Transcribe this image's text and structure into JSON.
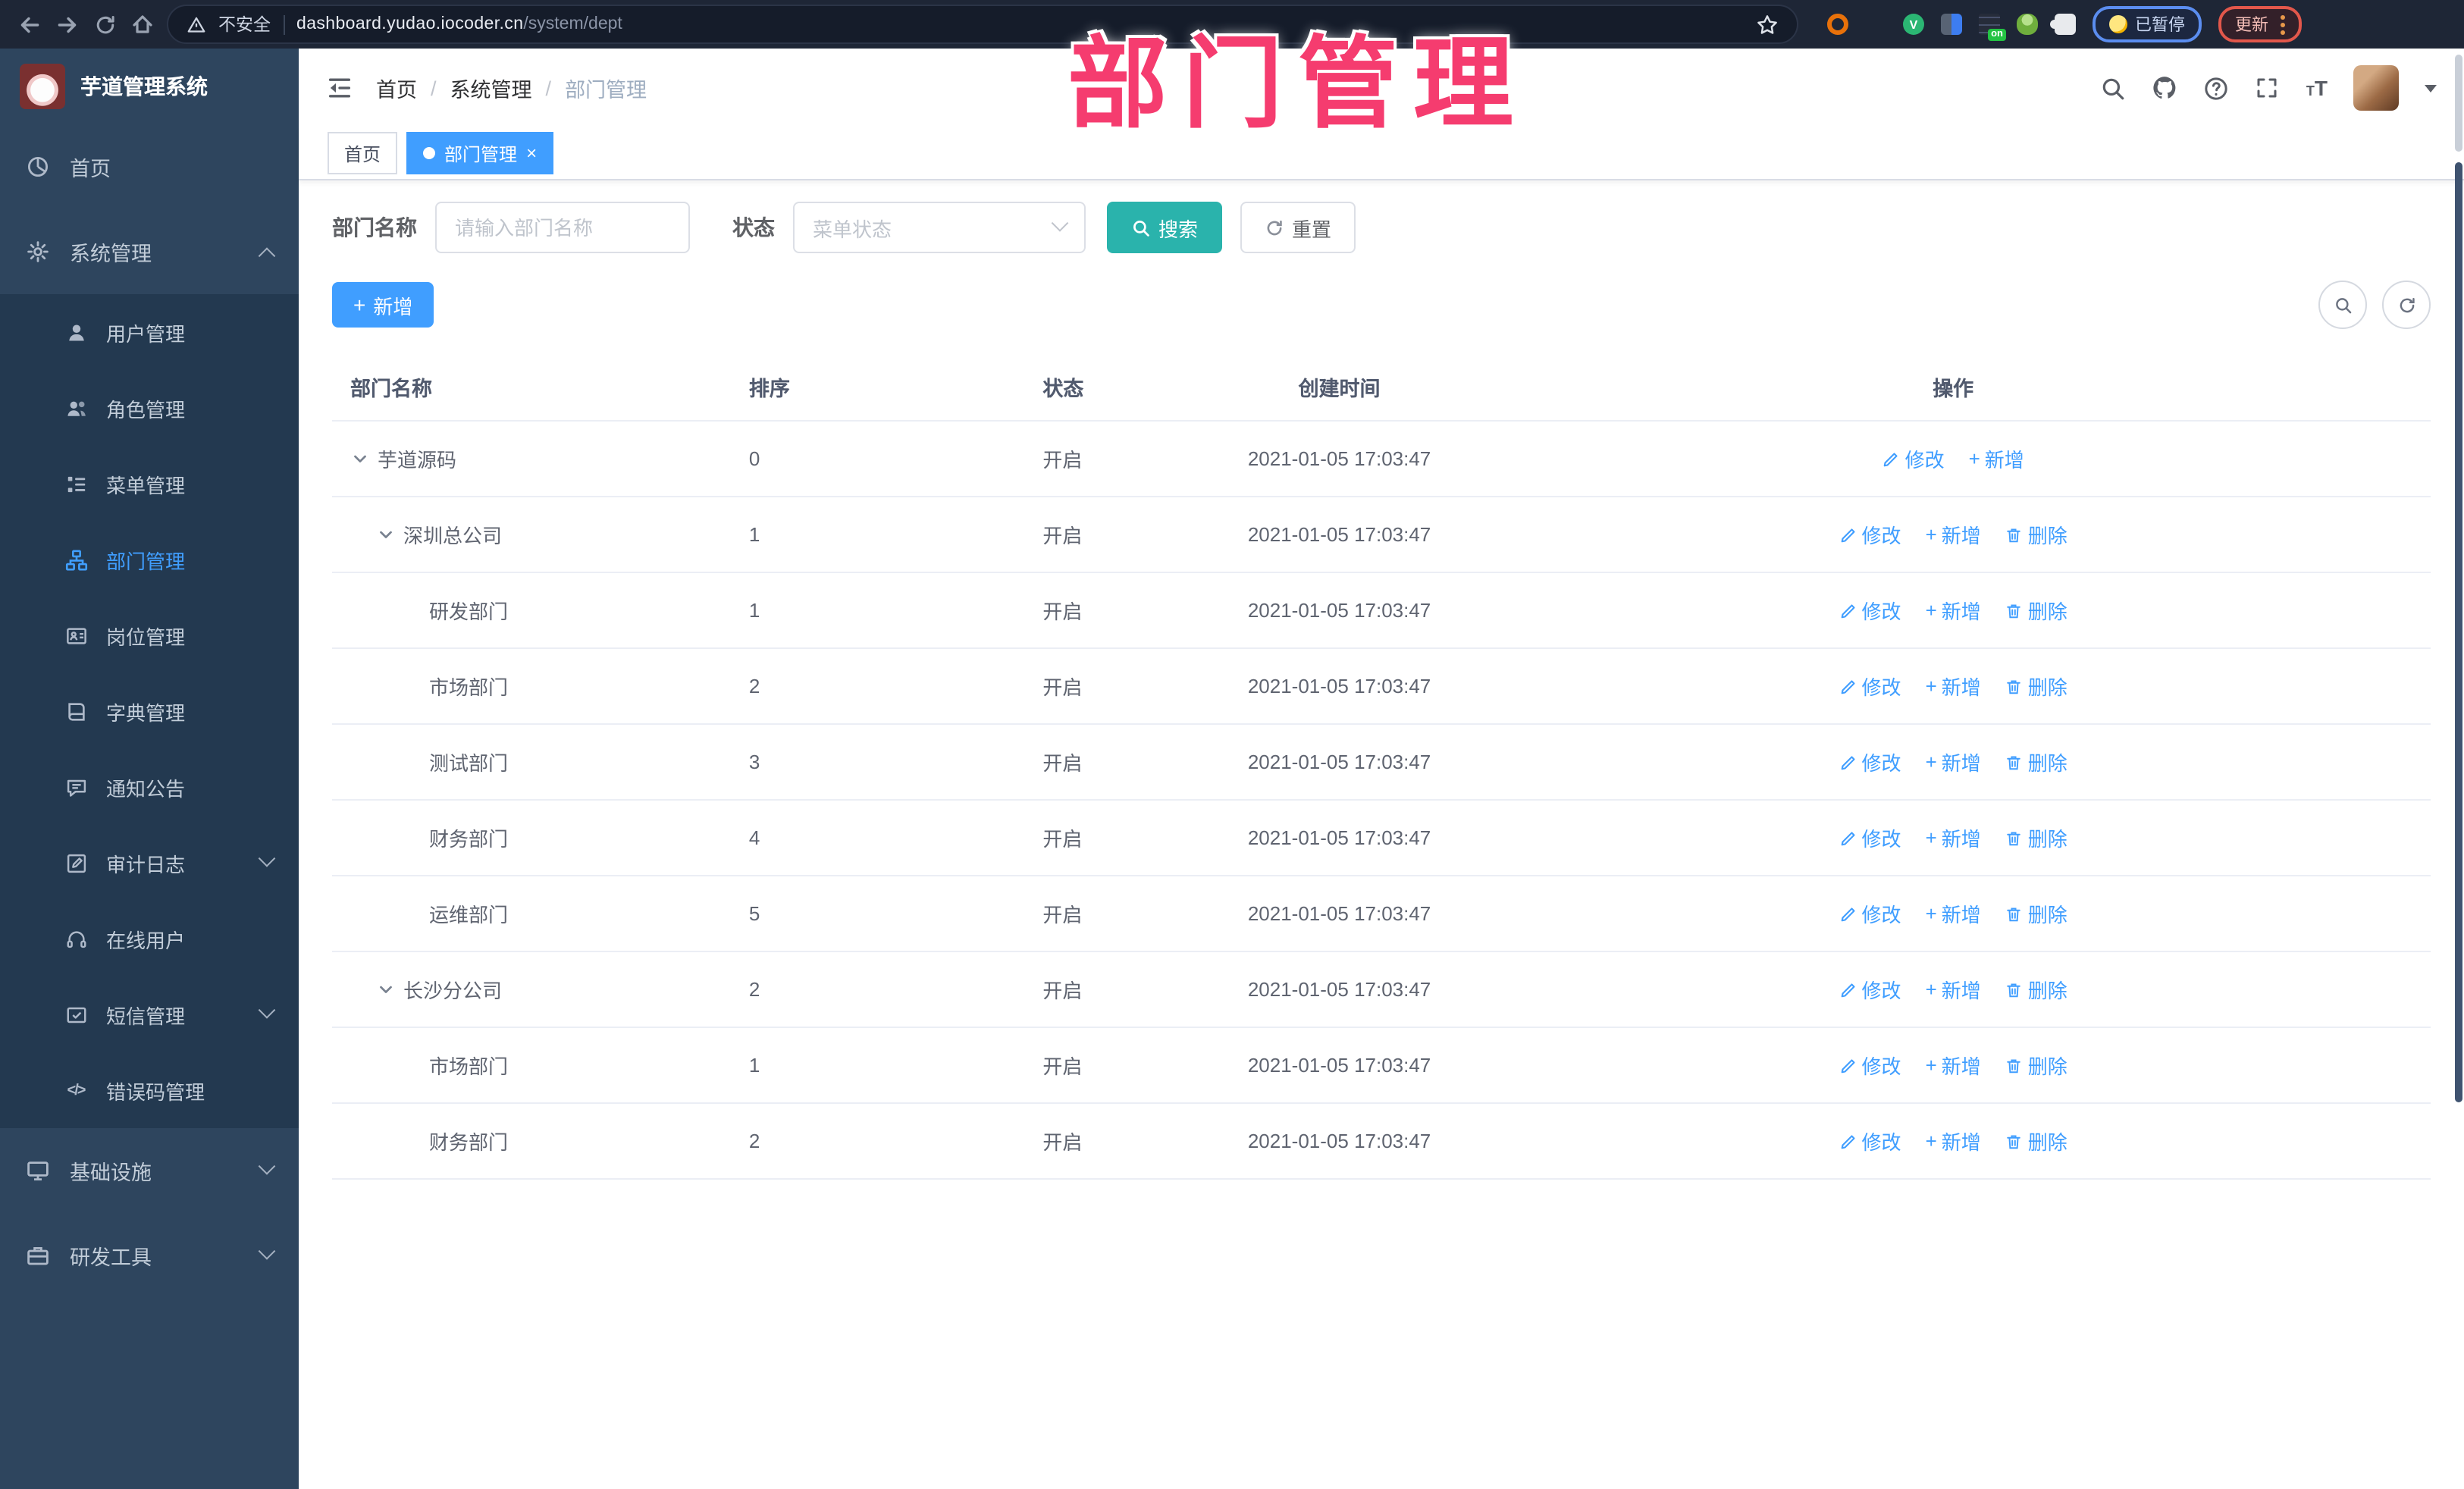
{
  "browser": {
    "security_label": "不安全",
    "url_host": "dashboard.yudao.iocoder.cn",
    "url_path": "/system/dept",
    "extension_badge": "on",
    "profile_chip_label": "已暂停",
    "update_button_label": "更新",
    "nav_icons": [
      "back-icon",
      "forward-icon",
      "refresh-icon",
      "home-icon",
      "warning-icon",
      "star-icon"
    ]
  },
  "annotation": {
    "text": "部门管理",
    "color": "#f53c6f"
  },
  "sidebar": {
    "logo_title": "芋道管理系统",
    "items": [
      {
        "label": "首页",
        "icon": "dashboard-icon"
      },
      {
        "label": "系统管理",
        "icon": "gear-icon",
        "chevron": "up"
      },
      {
        "label": "用户管理",
        "icon": "user-icon"
      },
      {
        "label": "角色管理",
        "icon": "users-icon"
      },
      {
        "label": "菜单管理",
        "icon": "menu-tree-icon"
      },
      {
        "label": "部门管理",
        "icon": "org-tree-icon",
        "active": true
      },
      {
        "label": "岗位管理",
        "icon": "badge-icon"
      },
      {
        "label": "字典管理",
        "icon": "dictionary-icon"
      },
      {
        "label": "通知公告",
        "icon": "announcement-icon"
      },
      {
        "label": "审计日志",
        "icon": "audit-log-icon",
        "chevron": "down"
      },
      {
        "label": "在线用户",
        "icon": "online-user-icon"
      },
      {
        "label": "短信管理",
        "icon": "sms-icon",
        "chevron": "down"
      },
      {
        "label": "错误码管理",
        "icon": "error-code-icon"
      },
      {
        "label": "基础设施",
        "icon": "infrastructure-icon",
        "chevron": "down"
      },
      {
        "label": "研发工具",
        "icon": "dev-tools-icon",
        "chevron": "down"
      }
    ]
  },
  "header": {
    "breadcrumb": [
      "首页",
      "系统管理",
      "部门管理"
    ],
    "right_icons": [
      "search-icon",
      "github-icon",
      "help-icon",
      "fullscreen-icon",
      "font-size-icon",
      "avatar",
      "caret-down-icon"
    ]
  },
  "tabs": [
    {
      "label": "首页",
      "active": false
    },
    {
      "label": "部门管理",
      "active": true,
      "closable": true
    }
  ],
  "filters": {
    "dept_name_label": "部门名称",
    "dept_name_placeholder": "请输入部门名称",
    "status_label": "状态",
    "status_placeholder": "菜单状态",
    "search_label": "搜索",
    "reset_label": "重置"
  },
  "toolbar": {
    "add_label": "新增"
  },
  "table": {
    "columns": [
      "部门名称",
      "排序",
      "状态",
      "创建时间",
      "操作"
    ],
    "actions": {
      "edit": "修改",
      "add": "新增",
      "delete": "删除"
    },
    "rows": [
      {
        "name": "芋道源码",
        "sort": "0",
        "status": "开启",
        "created": "2021-01-05 17:03:47",
        "level": 1,
        "expandable": true,
        "actions": [
          "edit",
          "add"
        ]
      },
      {
        "name": "深圳总公司",
        "sort": "1",
        "status": "开启",
        "created": "2021-01-05 17:03:47",
        "level": 2,
        "expandable": true,
        "actions": [
          "edit",
          "add",
          "delete"
        ]
      },
      {
        "name": "研发部门",
        "sort": "1",
        "status": "开启",
        "created": "2021-01-05 17:03:47",
        "level": 3,
        "expandable": false,
        "actions": [
          "edit",
          "add",
          "delete"
        ]
      },
      {
        "name": "市场部门",
        "sort": "2",
        "status": "开启",
        "created": "2021-01-05 17:03:47",
        "level": 3,
        "expandable": false,
        "actions": [
          "edit",
          "add",
          "delete"
        ]
      },
      {
        "name": "测试部门",
        "sort": "3",
        "status": "开启",
        "created": "2021-01-05 17:03:47",
        "level": 3,
        "expandable": false,
        "actions": [
          "edit",
          "add",
          "delete"
        ]
      },
      {
        "name": "财务部门",
        "sort": "4",
        "status": "开启",
        "created": "2021-01-05 17:03:47",
        "level": 3,
        "expandable": false,
        "actions": [
          "edit",
          "add",
          "delete"
        ]
      },
      {
        "name": "运维部门",
        "sort": "5",
        "status": "开启",
        "created": "2021-01-05 17:03:47",
        "level": 3,
        "expandable": false,
        "actions": [
          "edit",
          "add",
          "delete"
        ]
      },
      {
        "name": "长沙分公司",
        "sort": "2",
        "status": "开启",
        "created": "2021-01-05 17:03:47",
        "level": 2,
        "expandable": true,
        "actions": [
          "edit",
          "add",
          "delete"
        ]
      },
      {
        "name": "市场部门",
        "sort": "1",
        "status": "开启",
        "created": "2021-01-05 17:03:47",
        "level": 3,
        "expandable": false,
        "actions": [
          "edit",
          "add",
          "delete"
        ]
      },
      {
        "name": "财务部门",
        "sort": "2",
        "status": "开启",
        "created": "2021-01-05 17:03:47",
        "level": 3,
        "expandable": false,
        "actions": [
          "edit",
          "add",
          "delete"
        ]
      }
    ]
  },
  "colors": {
    "accent_blue": "#409eff",
    "search_button_teal": "#2ab3ac",
    "annotation_pink": "#f53c6f",
    "sidebar_bg": "#2e455e",
    "submenu_bg": "#233950",
    "chrome_bg": "#1e2636"
  }
}
